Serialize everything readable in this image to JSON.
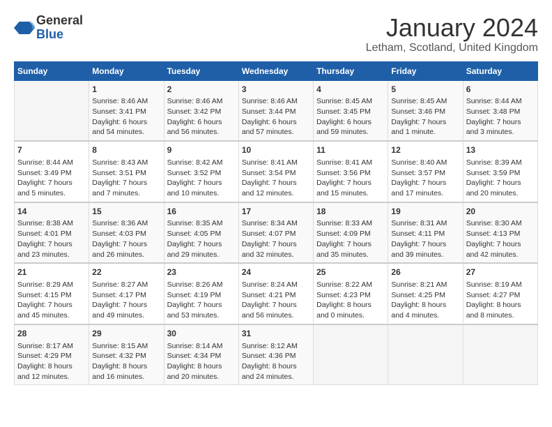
{
  "header": {
    "logo_line1": "General",
    "logo_line2": "Blue",
    "month_title": "January 2024",
    "location": "Letham, Scotland, United Kingdom"
  },
  "days_of_week": [
    "Sunday",
    "Monday",
    "Tuesday",
    "Wednesday",
    "Thursday",
    "Friday",
    "Saturday"
  ],
  "weeks": [
    [
      {
        "day": "",
        "info": ""
      },
      {
        "day": "1",
        "info": "Sunrise: 8:46 AM\nSunset: 3:41 PM\nDaylight: 6 hours\nand 54 minutes."
      },
      {
        "day": "2",
        "info": "Sunrise: 8:46 AM\nSunset: 3:42 PM\nDaylight: 6 hours\nand 56 minutes."
      },
      {
        "day": "3",
        "info": "Sunrise: 8:46 AM\nSunset: 3:44 PM\nDaylight: 6 hours\nand 57 minutes."
      },
      {
        "day": "4",
        "info": "Sunrise: 8:45 AM\nSunset: 3:45 PM\nDaylight: 6 hours\nand 59 minutes."
      },
      {
        "day": "5",
        "info": "Sunrise: 8:45 AM\nSunset: 3:46 PM\nDaylight: 7 hours\nand 1 minute."
      },
      {
        "day": "6",
        "info": "Sunrise: 8:44 AM\nSunset: 3:48 PM\nDaylight: 7 hours\nand 3 minutes."
      }
    ],
    [
      {
        "day": "7",
        "info": "Sunrise: 8:44 AM\nSunset: 3:49 PM\nDaylight: 7 hours\nand 5 minutes."
      },
      {
        "day": "8",
        "info": "Sunrise: 8:43 AM\nSunset: 3:51 PM\nDaylight: 7 hours\nand 7 minutes."
      },
      {
        "day": "9",
        "info": "Sunrise: 8:42 AM\nSunset: 3:52 PM\nDaylight: 7 hours\nand 10 minutes."
      },
      {
        "day": "10",
        "info": "Sunrise: 8:41 AM\nSunset: 3:54 PM\nDaylight: 7 hours\nand 12 minutes."
      },
      {
        "day": "11",
        "info": "Sunrise: 8:41 AM\nSunset: 3:56 PM\nDaylight: 7 hours\nand 15 minutes."
      },
      {
        "day": "12",
        "info": "Sunrise: 8:40 AM\nSunset: 3:57 PM\nDaylight: 7 hours\nand 17 minutes."
      },
      {
        "day": "13",
        "info": "Sunrise: 8:39 AM\nSunset: 3:59 PM\nDaylight: 7 hours\nand 20 minutes."
      }
    ],
    [
      {
        "day": "14",
        "info": "Sunrise: 8:38 AM\nSunset: 4:01 PM\nDaylight: 7 hours\nand 23 minutes."
      },
      {
        "day": "15",
        "info": "Sunrise: 8:36 AM\nSunset: 4:03 PM\nDaylight: 7 hours\nand 26 minutes."
      },
      {
        "day": "16",
        "info": "Sunrise: 8:35 AM\nSunset: 4:05 PM\nDaylight: 7 hours\nand 29 minutes."
      },
      {
        "day": "17",
        "info": "Sunrise: 8:34 AM\nSunset: 4:07 PM\nDaylight: 7 hours\nand 32 minutes."
      },
      {
        "day": "18",
        "info": "Sunrise: 8:33 AM\nSunset: 4:09 PM\nDaylight: 7 hours\nand 35 minutes."
      },
      {
        "day": "19",
        "info": "Sunrise: 8:31 AM\nSunset: 4:11 PM\nDaylight: 7 hours\nand 39 minutes."
      },
      {
        "day": "20",
        "info": "Sunrise: 8:30 AM\nSunset: 4:13 PM\nDaylight: 7 hours\nand 42 minutes."
      }
    ],
    [
      {
        "day": "21",
        "info": "Sunrise: 8:29 AM\nSunset: 4:15 PM\nDaylight: 7 hours\nand 45 minutes."
      },
      {
        "day": "22",
        "info": "Sunrise: 8:27 AM\nSunset: 4:17 PM\nDaylight: 7 hours\nand 49 minutes."
      },
      {
        "day": "23",
        "info": "Sunrise: 8:26 AM\nSunset: 4:19 PM\nDaylight: 7 hours\nand 53 minutes."
      },
      {
        "day": "24",
        "info": "Sunrise: 8:24 AM\nSunset: 4:21 PM\nDaylight: 7 hours\nand 56 minutes."
      },
      {
        "day": "25",
        "info": "Sunrise: 8:22 AM\nSunset: 4:23 PM\nDaylight: 8 hours\nand 0 minutes."
      },
      {
        "day": "26",
        "info": "Sunrise: 8:21 AM\nSunset: 4:25 PM\nDaylight: 8 hours\nand 4 minutes."
      },
      {
        "day": "27",
        "info": "Sunrise: 8:19 AM\nSunset: 4:27 PM\nDaylight: 8 hours\nand 8 minutes."
      }
    ],
    [
      {
        "day": "28",
        "info": "Sunrise: 8:17 AM\nSunset: 4:29 PM\nDaylight: 8 hours\nand 12 minutes."
      },
      {
        "day": "29",
        "info": "Sunrise: 8:15 AM\nSunset: 4:32 PM\nDaylight: 8 hours\nand 16 minutes."
      },
      {
        "day": "30",
        "info": "Sunrise: 8:14 AM\nSunset: 4:34 PM\nDaylight: 8 hours\nand 20 minutes."
      },
      {
        "day": "31",
        "info": "Sunrise: 8:12 AM\nSunset: 4:36 PM\nDaylight: 8 hours\nand 24 minutes."
      },
      {
        "day": "",
        "info": ""
      },
      {
        "day": "",
        "info": ""
      },
      {
        "day": "",
        "info": ""
      }
    ]
  ]
}
